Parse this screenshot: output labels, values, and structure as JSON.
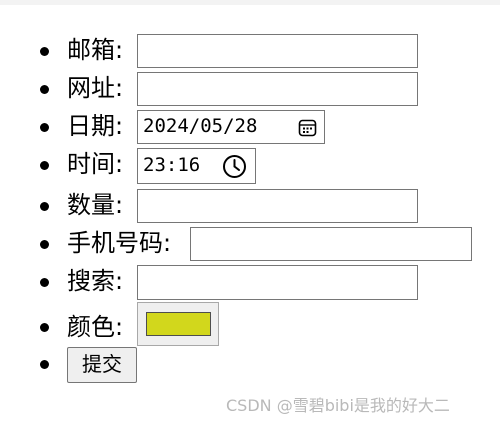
{
  "form": {
    "email_label": "邮箱:",
    "email_value": "",
    "url_label": "网址:",
    "url_value": "",
    "date_label": "日期:",
    "date_value": "2024/05/28",
    "time_label": "时间:",
    "time_value": "23:16",
    "number_label": "数量:",
    "number_value": "",
    "phone_label": "手机号码:",
    "phone_value": "",
    "search_label": "搜索:",
    "search_value": "",
    "color_label": "颜色:",
    "color_value": "#d2d71c",
    "submit_label": "提交"
  },
  "watermark": "CSDN @雪碧bibi是我的好大二",
  "icons": {
    "date": "calendar-icon",
    "time": "clock-icon"
  }
}
